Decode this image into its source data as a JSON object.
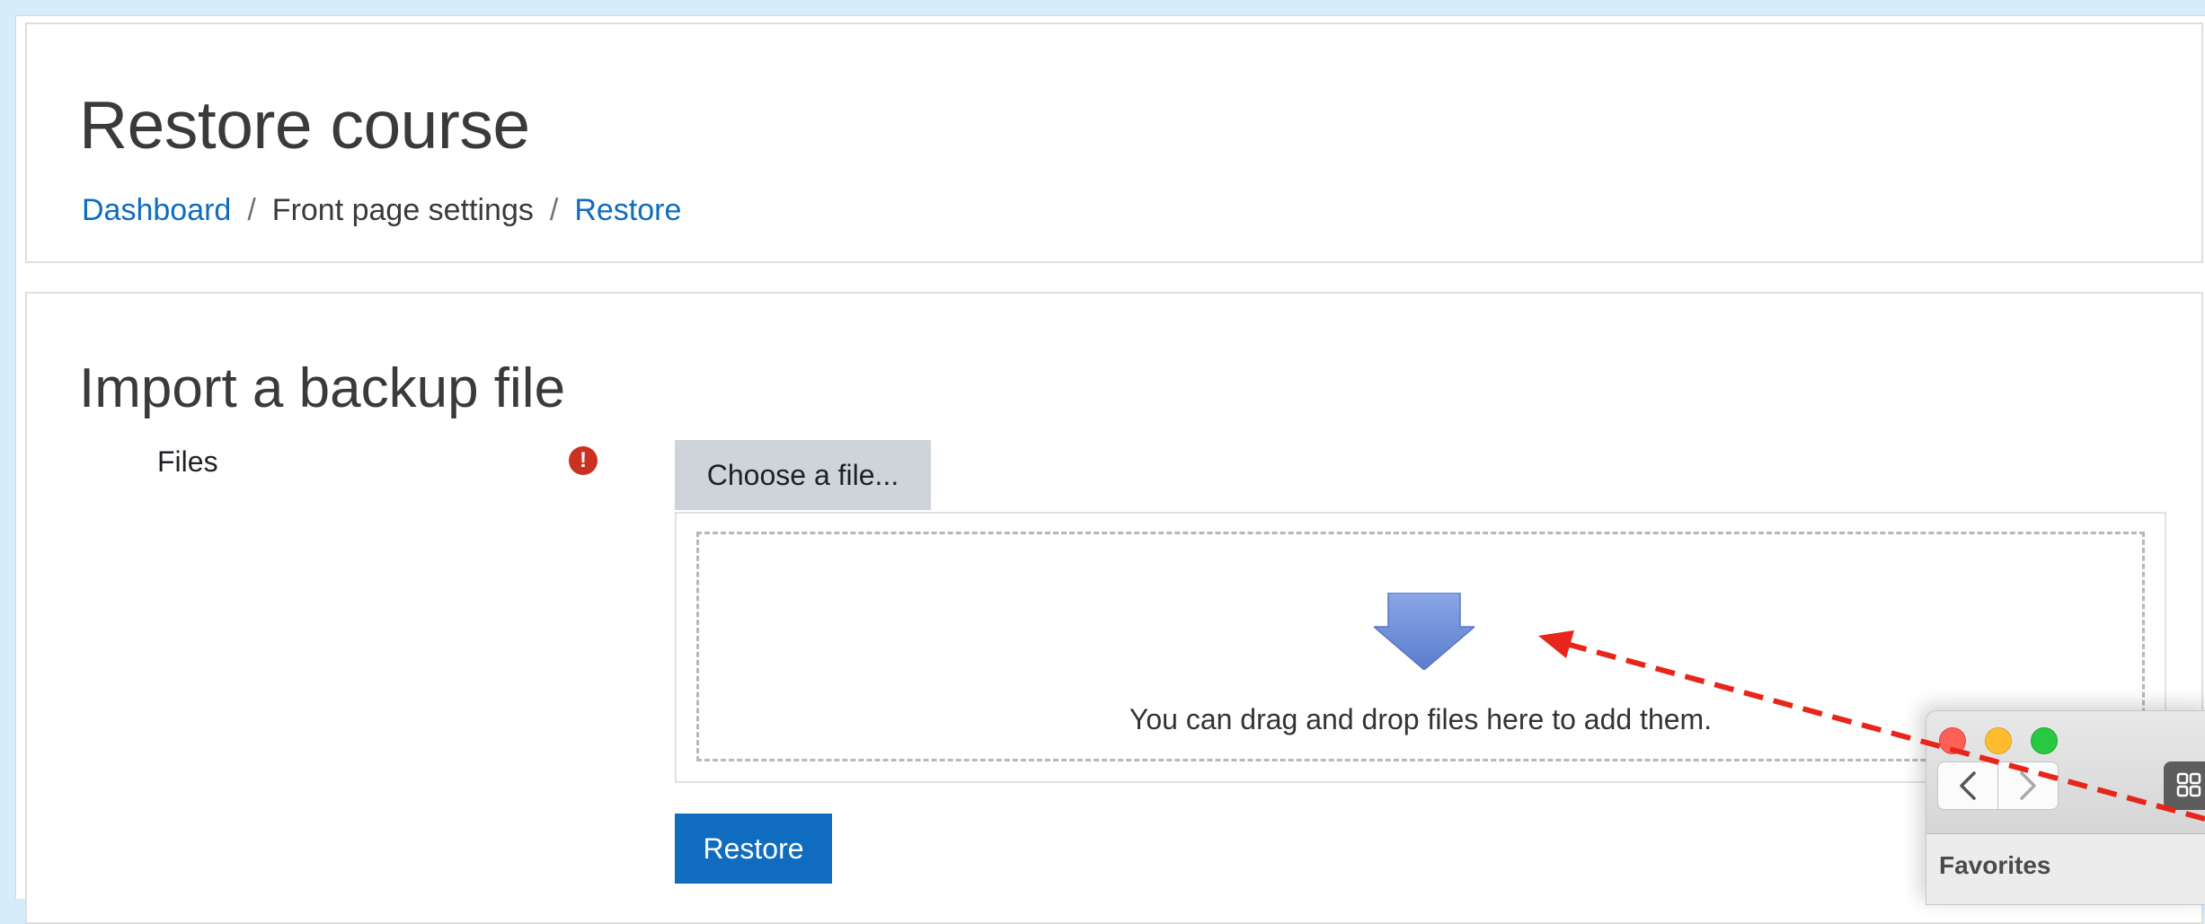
{
  "header": {
    "title": "Restore course",
    "breadcrumb": {
      "dashboard": "Dashboard",
      "separator": "/",
      "front_page_settings": "Front page settings",
      "restore": "Restore"
    }
  },
  "main": {
    "section_title": "Import a backup file",
    "files_label": "Files",
    "required_icon_glyph": "!",
    "choose_button": "Choose a file...",
    "drop_text": "You can drag and drop files here to add them.",
    "restore_button": "Restore",
    "icons": {
      "required": "exclamation-circle-icon",
      "drop": "down-arrow-icon"
    }
  },
  "finder": {
    "favorites_label": "Favorites",
    "back_glyph": "‹",
    "forward_glyph": "›",
    "icons": [
      "close-dot",
      "minimize-dot",
      "maximize-dot",
      "back-chevron-icon",
      "forward-chevron-icon",
      "grid-view-icon"
    ]
  },
  "colors": {
    "accent": "#0f6cbf",
    "required": "#ca3120",
    "drag_line": "#e8251a",
    "arrow": "#6f8fd6"
  }
}
